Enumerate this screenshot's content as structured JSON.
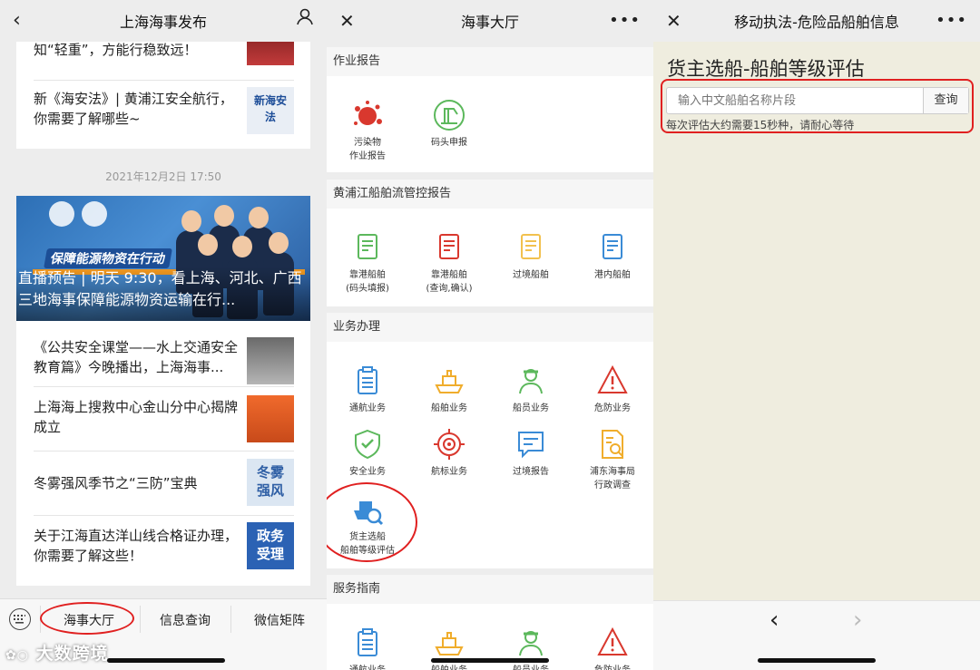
{
  "panel1": {
    "title": "上海海事发布",
    "articles_top": [
      {
        "text": "知“轻重”，方能行稳致远！"
      },
      {
        "text": "新《海安法》| 黄浦江安全航行，你需要了解哪些~",
        "thumb": "新海安法"
      }
    ],
    "timestamp": "2021年12月2日 17:50",
    "banner": {
      "tag": "保障能源物资在行动",
      "title": "直播预告 | 明天 9:30，看上海、河北、广西三地海事保障能源物资运输在行..."
    },
    "articles": [
      {
        "text": "《公共安全课堂——水上交通安全教育篇》今晚播出，上海海事..."
      },
      {
        "text": "上海海上搜救中心金山分中心揭牌成立"
      },
      {
        "text": "冬雾强风季节之“三防”宝典",
        "thumb": "冬雾强风"
      },
      {
        "text": "关于江海直达洋山线合格证办理，你需要了解这些！",
        "thumb": "政务受理"
      }
    ],
    "tabs": [
      "海事大厅",
      "信息查询",
      "微信矩阵"
    ],
    "watermark": "大数跨境"
  },
  "panel2": {
    "title": "海事大厅",
    "sections": [
      {
        "name": "作业报告",
        "items": [
          "污染物作业报告",
          "码头申报"
        ]
      },
      {
        "name": "黄浦江船舶流管控报告",
        "items": [
          "靠港船舶(码头填报)",
          "靠港船舶(查询,确认)",
          "过境船舶",
          "港内船舶"
        ]
      },
      {
        "name": "业务办理",
        "items": [
          "通航业务",
          "船舶业务",
          "船员业务",
          "危防业务",
          "安全业务",
          "航标业务",
          "过境报告",
          "浦东海事局行政调查",
          "货主选船船舶等级评估"
        ]
      },
      {
        "name": "服务指南",
        "items": [
          "通航业务",
          "船舶业务",
          "船员业务",
          "危防业务"
        ]
      }
    ],
    "item_lines": {
      "pollutant": [
        "污染物",
        "作业报告"
      ],
      "dock": [
        "码头申报"
      ],
      "berth_fill": [
        "靠港船舶",
        "(码头填报)"
      ],
      "berth_query": [
        "靠港船舶",
        "(查询,确认)"
      ],
      "transit": [
        "过境船舶"
      ],
      "inport": [
        "港内船舶"
      ],
      "nav": [
        "通航业务"
      ],
      "ship": [
        "船舶业务"
      ],
      "crew": [
        "船员业务"
      ],
      "danger": [
        "危防业务"
      ],
      "safety": [
        "安全业务"
      ],
      "beacon": [
        "航标业务"
      ],
      "transit_report": [
        "过境报告"
      ],
      "pudong": [
        "浦东海事局",
        "行政调查"
      ],
      "rating": [
        "货主选船",
        "船舶等级评估"
      ]
    },
    "colors": {
      "red": "#d9382e",
      "green": "#5cb85c",
      "blue": "#3a8bd6",
      "orange": "#f0ad2c",
      "yellow": "#f2c14e"
    }
  },
  "panel3": {
    "title": "移动执法-危险品船舶信息",
    "heading": "货主选船-船舶等级评估",
    "search_placeholder": "输入中文船舶名称片段",
    "search_button": "查询",
    "hint": "每次评估大约需要15秒种，请耐心等待"
  }
}
